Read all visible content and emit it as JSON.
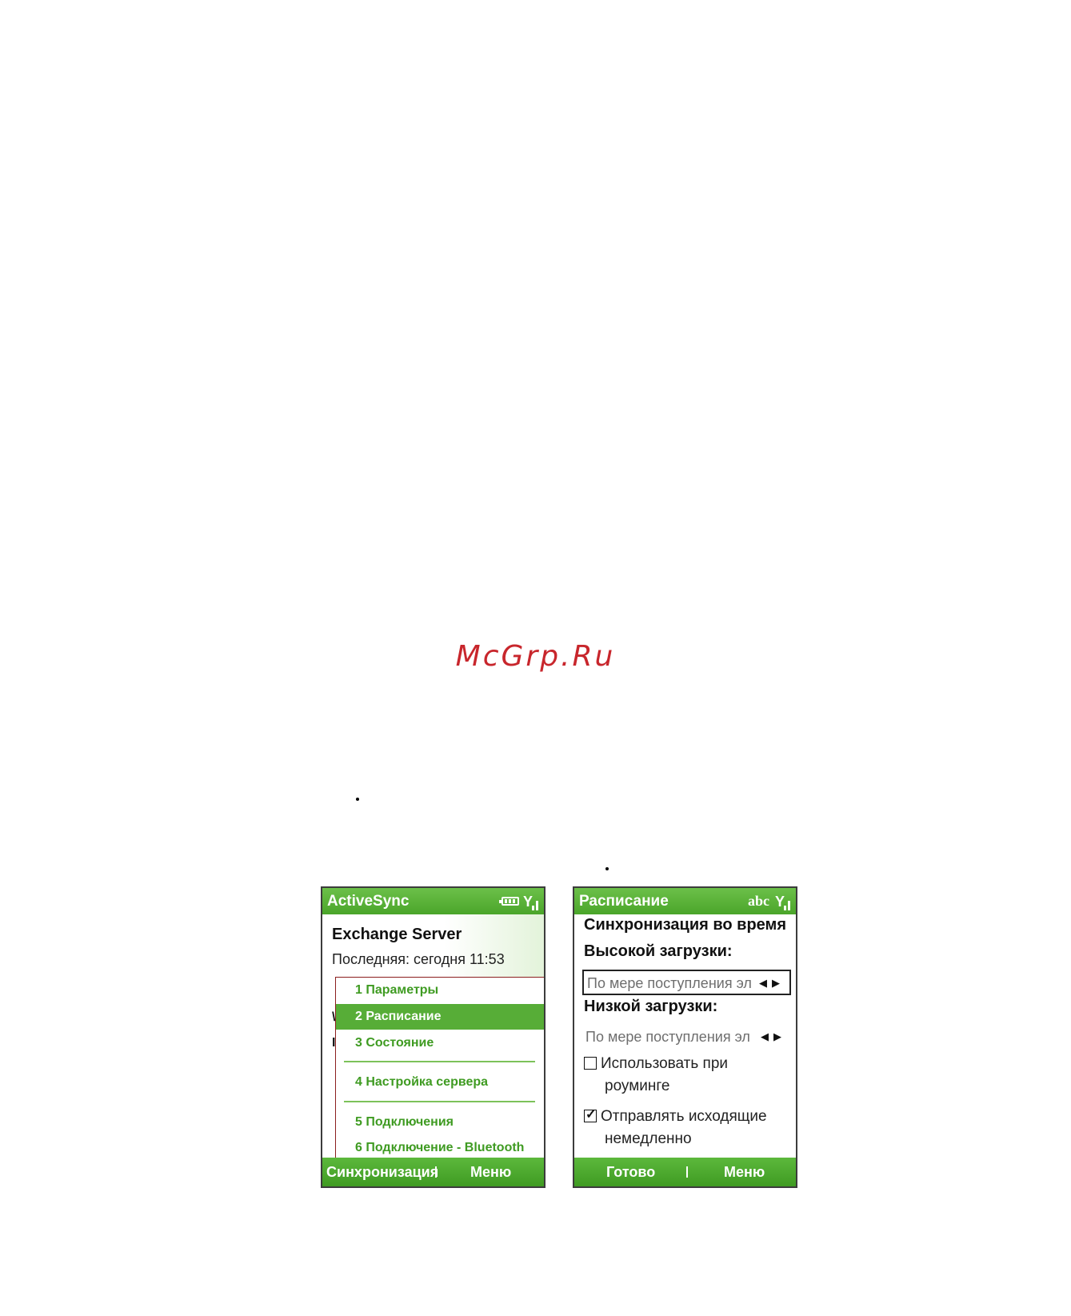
{
  "watermark": "McGrp.Ru",
  "screen1": {
    "title": "ActiveSync",
    "heading": "Exchange Server",
    "last_sync": "Последняя: сегодня  11:53",
    "menu_items": [
      "1 Параметры",
      "2 Расписание",
      "3 Состояние",
      "4 Настройка сервера",
      "5 Подключения",
      "6 Подключение - Bluetooth"
    ],
    "selected_index": 1,
    "left_softkey": "Синхронизация",
    "right_softkey": "Меню"
  },
  "screen2": {
    "title": "Расписание",
    "input_mode": "abc",
    "heading": "Синхронизация во время",
    "peak_label": "Высокой загрузки:",
    "peak_value": "По мере поступления эл",
    "offpeak_label": "Низкой загрузки:",
    "offpeak_value": "По мере поступления эл",
    "roaming_label_1": "Использовать при",
    "roaming_label_2": "роуминге",
    "roaming_checked": false,
    "send_label_1": "Отправлять исходящие",
    "send_label_2": "немедленно",
    "send_checked": true,
    "left_softkey": "Готово",
    "right_softkey": "Меню"
  },
  "colors": {
    "accent_green": "#4aa52a",
    "menu_text_green": "#3f9b22",
    "watermark_red": "#c8262c"
  }
}
